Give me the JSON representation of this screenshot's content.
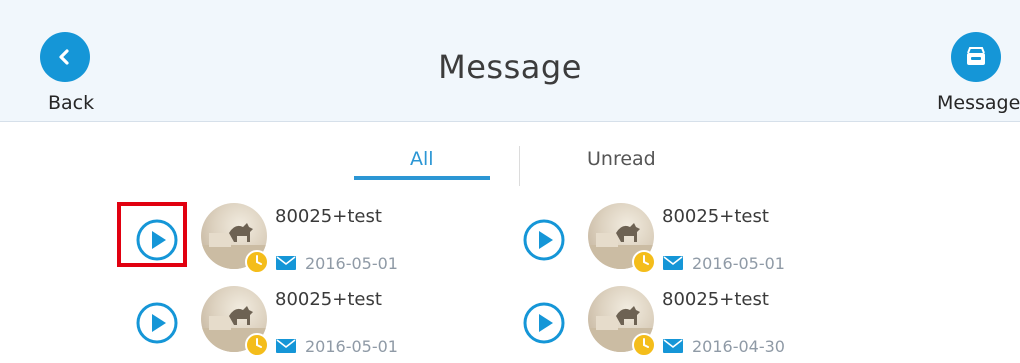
{
  "header": {
    "title": "Message",
    "back_label": "Back",
    "message_label": "Message"
  },
  "tabs": [
    {
      "label": "All",
      "active": true
    },
    {
      "label": "Unread",
      "active": false
    }
  ],
  "messages": [
    {
      "sender": "80025+test",
      "date": "2016-05-01"
    },
    {
      "sender": "80025+test",
      "date": "2016-05-01"
    },
    {
      "sender": "80025+test",
      "date": "2016-05-01"
    },
    {
      "sender": "80025+test",
      "date": "2016-04-30"
    }
  ],
  "colors": {
    "accent": "#1596d7",
    "header_bg": "#f1f7fc",
    "clock_badge": "#f4bd1b",
    "highlight": "#e10010"
  },
  "icons": {
    "back": "chevron-left-icon",
    "message": "inbox-tray-icon",
    "play": "play-circle-icon",
    "mail": "envelope-icon",
    "clock": "clock-icon"
  }
}
